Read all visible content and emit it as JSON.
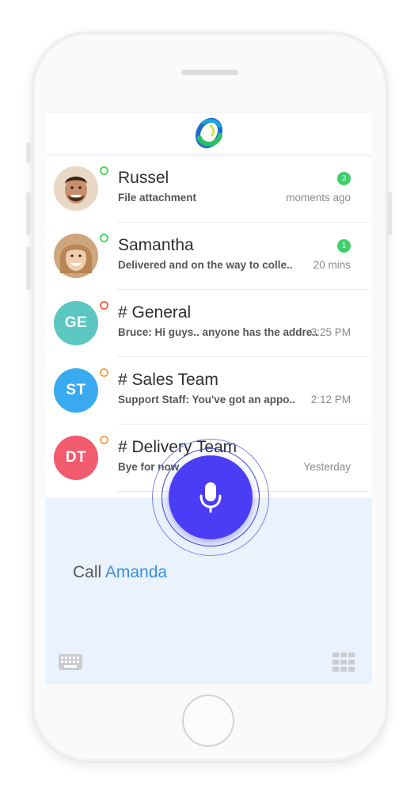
{
  "conversations": [
    {
      "name": "Russel",
      "preview": "File attachment",
      "time": "moments ago",
      "badge": "3",
      "presence_color": "#4cd964",
      "avatar_type": "photo",
      "avatar_bg": "#c99a7a"
    },
    {
      "name": "Samantha",
      "preview": "Delivered and on the way to colle..",
      "time": "20 mins",
      "badge": "1",
      "presence_color": "#4cd964",
      "avatar_type": "photo",
      "avatar_bg": "#d9a784"
    },
    {
      "name": "# General",
      "preview": "Bruce: Hi guys.. anyone has the addre..",
      "time": "3:25 PM",
      "initials": "GE",
      "presence_color": "#f06b4a",
      "avatar_bg": "#5cc6c0"
    },
    {
      "name": "# Sales Team",
      "preview": "Support Staff: You've got an appo..",
      "time": "2:12 PM",
      "initials": "ST",
      "presence_color": "#f2a554",
      "avatar_bg": "#3aaaf0"
    },
    {
      "name": "# Delivery Team",
      "preview": "Bye for now",
      "time": "Yesterday",
      "initials": "DT",
      "presence_color": "#f2a554",
      "avatar_bg": "#f25a6e"
    }
  ],
  "voice": {
    "prefix": "Call",
    "contact": "Amanda"
  },
  "icons": {
    "app_logo": "app-logo",
    "microphone": "microphone-icon",
    "keyboard": "keyboard-icon",
    "keypad": "keypad-icon"
  },
  "colors": {
    "accent": "#4a3df5",
    "link": "#3c8ee0",
    "voice_panel_bg": "#eaf2fd",
    "badge": "#3ecf6b"
  }
}
